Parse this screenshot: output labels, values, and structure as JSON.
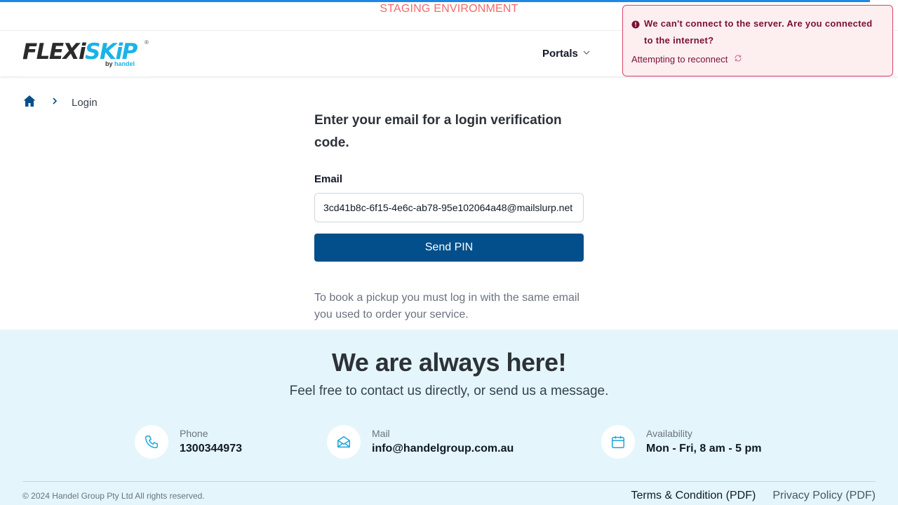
{
  "banner": {
    "text": "STAGING ENVIRONMENT"
  },
  "logo": {
    "brand_dark": "FLEXi",
    "brand_light": "SKiP",
    "registered": "®",
    "by": "by",
    "maker": "handel"
  },
  "nav": {
    "portals": "Portals"
  },
  "toast": {
    "title": "We can't connect to the server. Are you connected to the internet?",
    "status": "Attempting to reconnect"
  },
  "breadcrumb": {
    "current": "Login"
  },
  "form": {
    "title": "Enter your email for a login verification code.",
    "email_label": "Email",
    "email_value": "3cd41b8c-6f15-4e6c-ab78-95e102064a48@mailslurp.net",
    "submit": "Send PIN",
    "note": "To book a pickup you must log in with the same email you used to order your service."
  },
  "footer": {
    "title": "We are always here!",
    "subtitle": "Feel free to contact us directly, or send us a message.",
    "contacts": [
      {
        "label": "Phone",
        "value": "1300344973",
        "icon": "phone-icon"
      },
      {
        "label": "Mail",
        "value": "info@handelgroup.com.au",
        "icon": "mail-icon"
      },
      {
        "label": "Availability",
        "value": "Mon - Fri, 8 am - 5 pm",
        "icon": "calendar-icon"
      }
    ],
    "copyright": "© 2024 Handel Group Pty Ltd All rights reserved.",
    "terms": "Terms & Condition (PDF)",
    "privacy": "Privacy Policy (PDF)"
  },
  "colors": {
    "primary": "#034f8b",
    "accent": "#1ab3e8",
    "staging": "#f26b6b",
    "error_bg": "#fdeef0",
    "error_border": "#d8466a",
    "footer_bg": "#e4f6fb"
  }
}
